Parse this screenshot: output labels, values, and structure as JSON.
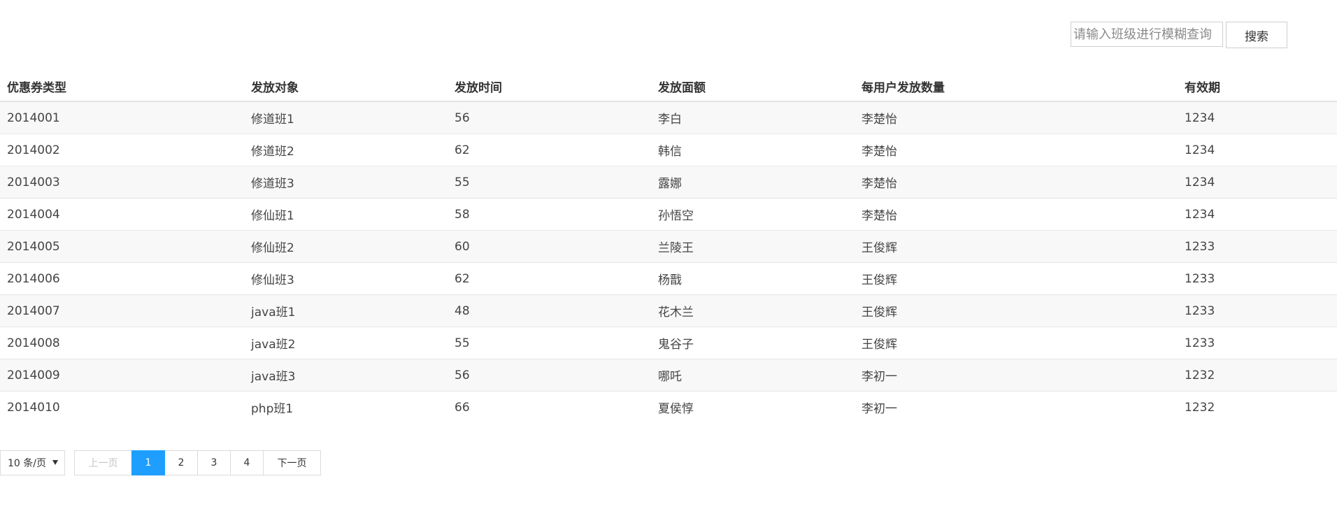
{
  "search": {
    "placeholder": "请输入班级进行模糊查询",
    "button_label": "搜索"
  },
  "table": {
    "columns": [
      "优惠券类型",
      "发放对象",
      "发放时间",
      "发放面额",
      "每用户发放数量",
      "有效期"
    ],
    "rows": [
      [
        "2014001",
        "修道班1",
        "56",
        "李白",
        "李楚怡",
        "1234"
      ],
      [
        "2014002",
        "修道班2",
        "62",
        "韩信",
        "李楚怡",
        "1234"
      ],
      [
        "2014003",
        "修道班3",
        "55",
        "露娜",
        "李楚怡",
        "1234"
      ],
      [
        "2014004",
        "修仙班1",
        "58",
        "孙悟空",
        "李楚怡",
        "1234"
      ],
      [
        "2014005",
        "修仙班2",
        "60",
        "兰陵王",
        "王俊辉",
        "1233"
      ],
      [
        "2014006",
        "修仙班3",
        "62",
        "杨戬",
        "王俊辉",
        "1233"
      ],
      [
        "2014007",
        "java班1",
        "48",
        "花木兰",
        "王俊辉",
        "1233"
      ],
      [
        "2014008",
        "java班2",
        "55",
        "鬼谷子",
        "王俊辉",
        "1233"
      ],
      [
        "2014009",
        "java班3",
        "56",
        "哪吒",
        "李初一",
        "1232"
      ],
      [
        "2014010",
        "php班1",
        "66",
        "夏侯惇",
        "李初一",
        "1232"
      ]
    ]
  },
  "pagination": {
    "page_size_label": "10 条/页",
    "dropdown_icon": "caret-down-icon",
    "prev_label": "上一页",
    "pages": [
      "1",
      "2",
      "3",
      "4"
    ],
    "active_page": "1",
    "next_label": "下一页"
  },
  "colors": {
    "accent": "#1e9fff",
    "row_stripe": "#f8f8f8",
    "border": "#e6e6e6"
  }
}
